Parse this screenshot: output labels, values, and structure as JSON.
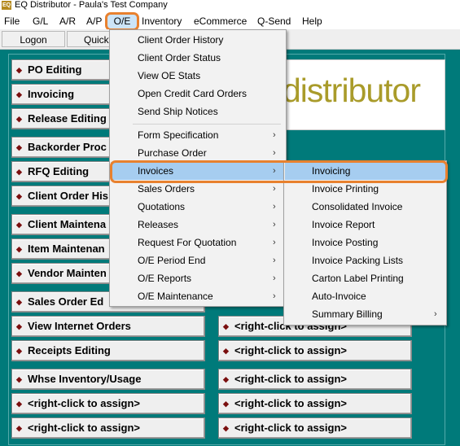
{
  "window": {
    "title": "EQ Distributor - Paula's Test Company",
    "icon_label": "EQ"
  },
  "menubar": [
    {
      "label": "File"
    },
    {
      "label": "G/L"
    },
    {
      "label": "A/R"
    },
    {
      "label": "A/P"
    },
    {
      "label": "O/E"
    },
    {
      "label": "Inventory"
    },
    {
      "label": "eCommerce"
    },
    {
      "label": "Q-Send"
    },
    {
      "label": "Help"
    }
  ],
  "toolbar": {
    "logon": "Logon",
    "quick": "Quick"
  },
  "logo": {
    "text": "distributor"
  },
  "shortcuts_left": [
    {
      "label": "PO Editing"
    },
    {
      "label": "Invoicing"
    },
    {
      "label": "Release Editing"
    },
    {
      "label": "Backorder Proc"
    },
    {
      "label": "RFQ Editing"
    },
    {
      "label": "Client Order His"
    },
    {
      "label": "Client Maintena"
    },
    {
      "label": "Item Maintenan"
    },
    {
      "label": "Vendor Mainten"
    },
    {
      "label": "Sales Order Ed"
    },
    {
      "label": "View Internet Orders"
    },
    {
      "label": "Receipts Editing"
    },
    {
      "label": "Whse Inventory/Usage"
    },
    {
      "label": "<right-click to assign>"
    },
    {
      "label": "<right-click to assign>"
    }
  ],
  "shortcuts_right": [
    {
      "label": "<right-click to assign>"
    },
    {
      "label": "<right-click to assign>"
    },
    {
      "label": "<right-click to assign>"
    },
    {
      "label": "<right-click to assign>"
    },
    {
      "label": "<right-click to assign>"
    }
  ],
  "oe_menu": {
    "group1": [
      {
        "label": "Client Order History"
      },
      {
        "label": "Client Order Status"
      },
      {
        "label": "View OE Stats"
      },
      {
        "label": "Open Credit Card Orders"
      },
      {
        "label": "Send Ship Notices"
      }
    ],
    "group2": [
      {
        "label": "Form Specification",
        "arrow": "›"
      },
      {
        "label": "Purchase Order",
        "arrow": "›"
      },
      {
        "label": "Invoices",
        "arrow": "›"
      },
      {
        "label": "Sales Orders",
        "arrow": "›"
      },
      {
        "label": "Quotations",
        "arrow": "›"
      },
      {
        "label": "Releases",
        "arrow": "›"
      },
      {
        "label": "Request For Quotation",
        "arrow": "›"
      },
      {
        "label": "O/E Period End",
        "arrow": "›"
      },
      {
        "label": "O/E Reports",
        "arrow": "›"
      },
      {
        "label": "O/E Maintenance",
        "arrow": "›"
      }
    ]
  },
  "invoices_menu": [
    {
      "label": "Invoicing"
    },
    {
      "label": "Invoice Printing"
    },
    {
      "label": "Consolidated Invoice"
    },
    {
      "label": "Invoice Report"
    },
    {
      "label": "Invoice Posting"
    },
    {
      "label": "Invoice Packing Lists"
    },
    {
      "label": "Carton Label Printing"
    },
    {
      "label": "Auto-Invoice"
    },
    {
      "label": "Summary Billing",
      "arrow": "›"
    }
  ],
  "colors": {
    "background": "#007a7a",
    "highlight": "#e8812f",
    "selection": "#a6cdf0",
    "logo": "#a99b2a"
  }
}
